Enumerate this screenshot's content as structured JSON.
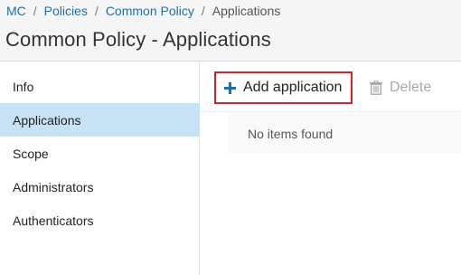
{
  "breadcrumb": {
    "items": [
      "MC",
      "Policies",
      "Common Policy",
      "Applications"
    ],
    "separator": "/"
  },
  "page": {
    "title": "Common Policy - Applications"
  },
  "sidebar": {
    "items": [
      {
        "label": "Info",
        "active": false
      },
      {
        "label": "Applications",
        "active": true
      },
      {
        "label": "Scope",
        "active": false
      },
      {
        "label": "Administrators",
        "active": false
      },
      {
        "label": "Authenticators",
        "active": false
      }
    ]
  },
  "toolbar": {
    "add_label": "Add application",
    "add_icon": "plus-icon",
    "delete_label": "Delete",
    "delete_icon": "trash-icon",
    "delete_enabled": false
  },
  "table": {
    "empty_text": "No items found"
  },
  "colors": {
    "link": "#1f6fa9",
    "active_nav": "#c5e3f5",
    "highlight_border": "#d9202c",
    "plus_icon": "#1f6fa9",
    "disabled": "#a8a8a8"
  }
}
